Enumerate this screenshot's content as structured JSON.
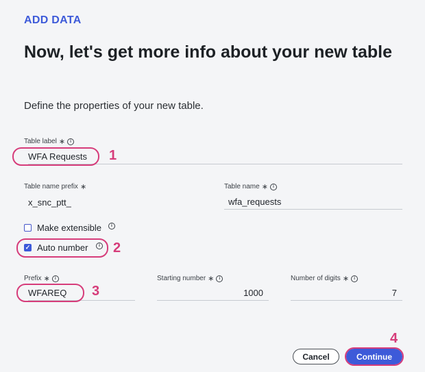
{
  "header": {
    "eyebrow": "ADD DATA",
    "title": "Now, let's get more info about your new table",
    "subtitle": "Define the properties of your new table."
  },
  "form": {
    "table_label": {
      "label": "Table label",
      "value": "WFA Requests"
    },
    "table_name_prefix": {
      "label": "Table name prefix",
      "value": "x_snc_ptt_"
    },
    "table_name": {
      "label": "Table name",
      "value": "wfa_requests"
    },
    "make_extensible": {
      "label": "Make extensible",
      "checked": false
    },
    "auto_number": {
      "label": "Auto number",
      "checked": true
    },
    "prefix": {
      "label": "Prefix",
      "value": "WFAREQ"
    },
    "starting_number": {
      "label": "Starting number",
      "value": "1000"
    },
    "number_of_digits": {
      "label": "Number of digits",
      "value": "7"
    }
  },
  "markers": {
    "m1": "1",
    "m2": "2",
    "m3": "3",
    "m4": "4"
  },
  "actions": {
    "cancel": "Cancel",
    "continue": "Continue"
  },
  "colors": {
    "accent": "#3d5ad9",
    "annotation": "#d63c7a",
    "background": "#f4f5f7"
  },
  "symbols": {
    "required": "∗",
    "info": "i"
  }
}
